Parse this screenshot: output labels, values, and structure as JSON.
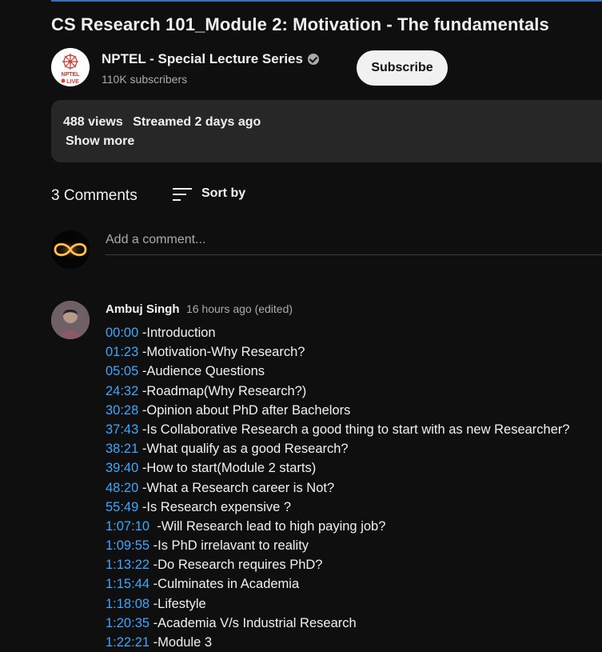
{
  "video": {
    "title": "CS Research 101_Module 2: Motivation - The fundamentals"
  },
  "channel": {
    "name": "NPTEL - Special Lecture Series",
    "subscribers": "110K subscribers",
    "subscribe_label": "Subscribe",
    "logo_text": "NPTEL",
    "logo_live": "LIVE"
  },
  "description": {
    "views": "488 views",
    "streamed": "Streamed 2 days ago",
    "show_more_label": "Show more"
  },
  "comments": {
    "count_label": "3 Comments",
    "sort_label": "Sort by",
    "add_placeholder": "Add a comment...",
    "items": [
      {
        "author": "Ambuj Singh",
        "time": "16 hours ago (edited)",
        "lines": [
          {
            "ts": "00:00",
            "text": " -Introduction"
          },
          {
            "ts": "01:23",
            "text": " -Motivation-Why Research?"
          },
          {
            "ts": "05:05",
            "text": " -Audience Questions"
          },
          {
            "ts": "24:32",
            "text": " -Roadmap(Why Research?)"
          },
          {
            "ts": "30:28",
            "text": " -Opinion about PhD after Bachelors"
          },
          {
            "ts": "37:43",
            "text": " -Is Collaborative Research a good thing to start with as new Researcher?"
          },
          {
            "ts": "38:21",
            "text": " -What qualify as a good Research?"
          },
          {
            "ts": "39:40",
            "text": " -How to start(Module 2 starts)"
          },
          {
            "ts": "48:20",
            "text": " -What a Research career is Not?"
          },
          {
            "ts": "55:49",
            "text": " -Is Research expensive ?"
          },
          {
            "ts": "1:07:10",
            "text": "  -Will Research lead to high paying job?"
          },
          {
            "ts": "1:09:55",
            "text": " -Is PhD irrelavant to reality"
          },
          {
            "ts": "1:13:22",
            "text": " -Do Research requires PhD?"
          },
          {
            "ts": "1:15:44",
            "text": " -Culminates in Academia"
          },
          {
            "ts": "1:18:08",
            "text": " -Lifestyle"
          },
          {
            "ts": "1:20:35",
            "text": " -Academia V/s Industrial Research"
          },
          {
            "ts": "1:22:21",
            "text": " -Module 3"
          }
        ]
      }
    ]
  },
  "colors": {
    "background": "#0f0f0f",
    "timestamp_link": "#3ea6ff",
    "card": "#272727"
  }
}
